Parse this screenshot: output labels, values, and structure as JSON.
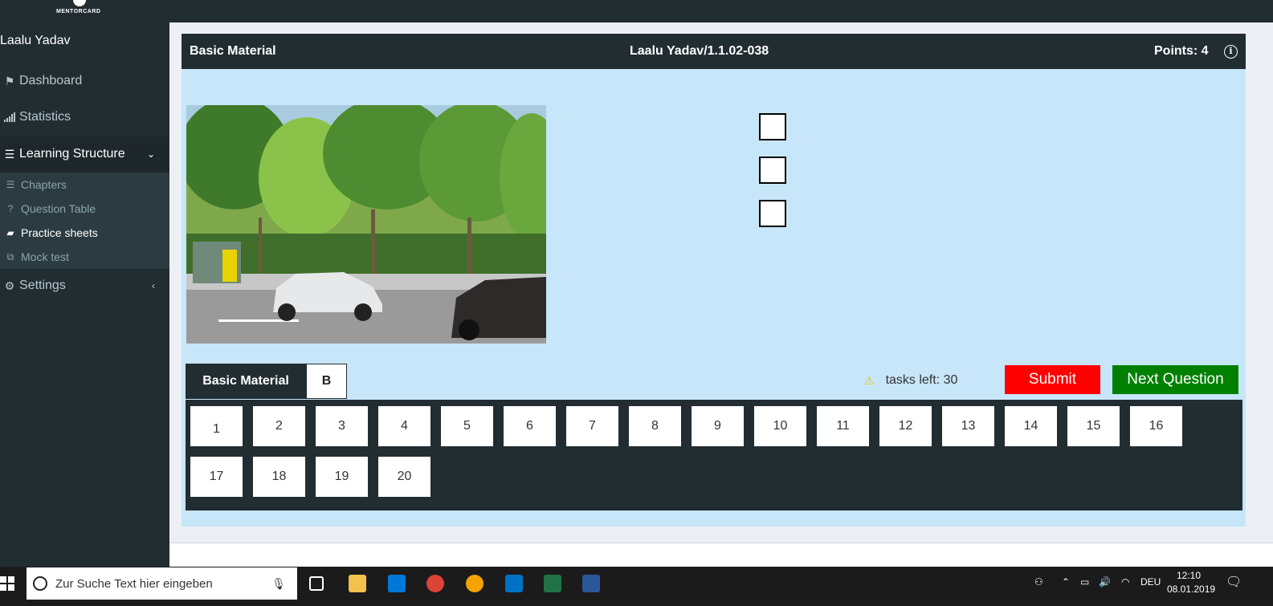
{
  "brand": {
    "logo_text": "MENTORCARD"
  },
  "sidebar": {
    "user_name": "Laalu Yadav",
    "items": [
      {
        "label": "Dashboard",
        "icon": "flag-icon"
      },
      {
        "label": "Statistics",
        "icon": "signal-icon"
      },
      {
        "label": "Learning Structure",
        "icon": "list-icon"
      }
    ],
    "sub_items": [
      {
        "label": "Chapters",
        "icon": "list-icon"
      },
      {
        "label": "Question Table",
        "icon": "question-circle-icon"
      },
      {
        "label": "Practice sheets",
        "icon": "book-icon"
      },
      {
        "label": "Mock test",
        "icon": "clone-icon"
      }
    ],
    "settings_label": "Settings"
  },
  "panel": {
    "left_title": "Basic Material",
    "center_title": "Laalu Yadav/1.1.02-038",
    "points_label": "Points: 4",
    "info_glyph": "i"
  },
  "tabs": {
    "tab1": "Basic Material",
    "tab2": "B"
  },
  "tasks_left": "tasks left: 30",
  "buttons": {
    "submit": "Submit",
    "next": "Next Question"
  },
  "questions": [
    "1",
    "2",
    "3",
    "4",
    "5",
    "6",
    "7",
    "8",
    "9",
    "10",
    "11",
    "12",
    "13",
    "14",
    "15",
    "16",
    "17",
    "18",
    "19",
    "20"
  ],
  "taskbar": {
    "search_placeholder": "Zur Suche Text hier eingeben",
    "lang": "DEU",
    "time": "12:10",
    "date": "08.01.2019"
  },
  "colors": {
    "sidebar": "#222d32",
    "panel": "#c8e6f9",
    "submit": "#ff0000",
    "next": "#008000"
  }
}
